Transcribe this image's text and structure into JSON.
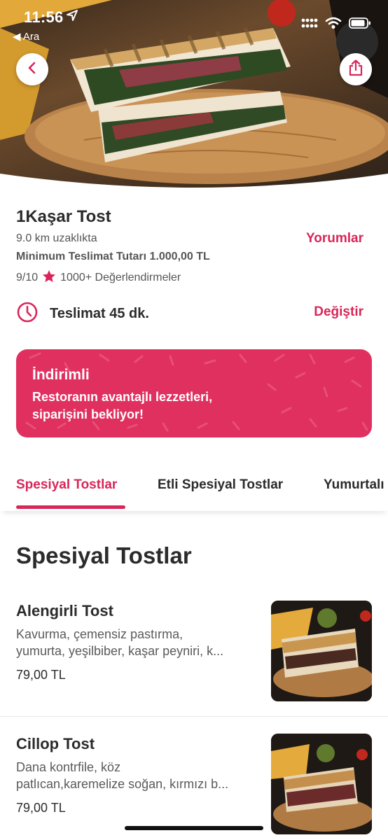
{
  "status_bar": {
    "time": "11:56",
    "back_label": "◀ Ara"
  },
  "restaurant": {
    "name": "1Kaşar Tost",
    "distance": "9.0 km uzaklıkta",
    "min_order": "Minimum Teslimat Tutarı 1.000,00 TL",
    "rating": "9/10",
    "rating_count": "1000+ Değerlendirmeler",
    "reviews_link": "Yorumlar"
  },
  "delivery": {
    "text": "Teslimat 45 dk.",
    "change_label": "Değiştir"
  },
  "promo": {
    "title": "İndirimli",
    "line1": "Restoranın avantajlı lezzetleri,",
    "line2": "siparişini bekliyor!"
  },
  "tabs": [
    {
      "label": "Spesiyal Tostlar",
      "active": true
    },
    {
      "label": "Etli Spesiyal Tostlar",
      "active": false
    },
    {
      "label": "Yumurtalı",
      "active": false
    }
  ],
  "section": {
    "title": "Spesiyal Tostlar"
  },
  "items": [
    {
      "name": "Alengirli Tost",
      "desc_line1": "Kavurma, çemensiz pastırma,",
      "desc_line2": "yumurta, yeşilbiber, kaşar peyniri, k...",
      "price": "79,00 TL"
    },
    {
      "name": "Cillop Tost",
      "desc_line1": "Dana kontrfile, köz",
      "desc_line2": "patlıcan,karemelize soğan, kırmızı b...",
      "price": "79,00 TL"
    }
  ],
  "colors": {
    "accent": "#d92659",
    "promo_bg": "#e0305f",
    "text": "#2b2b2b",
    "muted": "#555555"
  },
  "icons": {
    "back": "chevron-left-icon",
    "share": "share-icon",
    "clock": "clock-icon",
    "star": "star-icon",
    "location": "location-arrow-icon",
    "signal": "signal-icon",
    "wifi": "wifi-icon",
    "battery": "battery-icon"
  }
}
